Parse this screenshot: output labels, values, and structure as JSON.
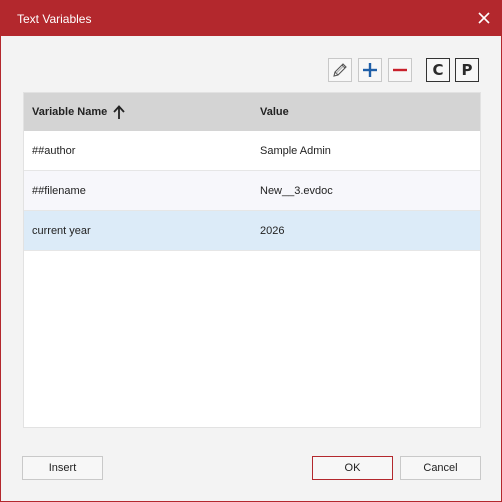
{
  "window": {
    "title": "Text Variables"
  },
  "icons": {
    "close": "close-icon",
    "edit": "pencil-icon",
    "add": "plus-icon",
    "remove": "minus-icon",
    "sort": "arrow-up-icon"
  },
  "toolbar": {
    "copy_label": "C",
    "paste_label": "P"
  },
  "table": {
    "columns": [
      "Variable Name",
      "Value"
    ],
    "sort": {
      "column": "Variable Name",
      "direction": "ascending"
    },
    "rows": [
      {
        "name": "##author",
        "value": "Sample Admin"
      },
      {
        "name": "##filename",
        "value": "New__3.evdoc"
      },
      {
        "name": "current year",
        "value": "2026"
      }
    ],
    "selected_row": "current year"
  },
  "buttons": {
    "insert": "Insert",
    "ok": "OK",
    "cancel": "Cancel"
  },
  "colors": {
    "accent": "#b3282d",
    "selection": "#dcebf8",
    "icon_blue": "#1f5fa8",
    "icon_red": "#c8202b"
  }
}
